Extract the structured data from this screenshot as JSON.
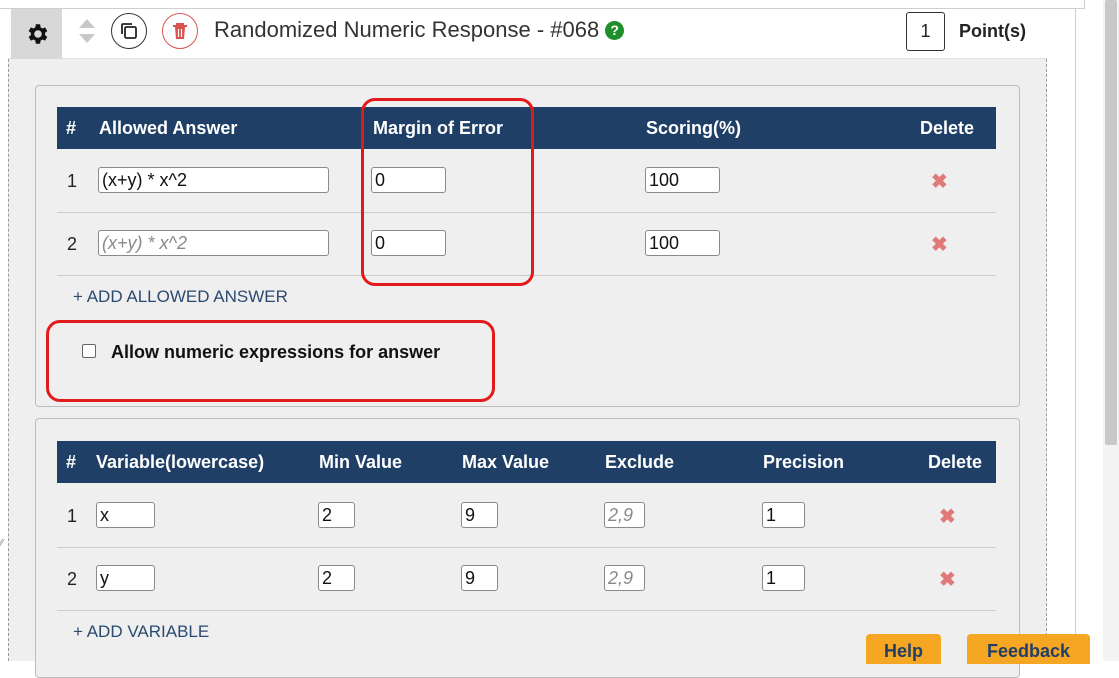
{
  "header": {
    "title": "Randomized Numeric Response - #068",
    "help_glyph": "?",
    "points_value": "1",
    "points_label": "Point(s)"
  },
  "answers": {
    "columns": [
      "#",
      "Allowed Answer",
      "Margin of Error",
      "Scoring(%)",
      "Delete"
    ],
    "rows": [
      {
        "num": "1",
        "answer": "(x+y) * x^2",
        "answer_placeholder": "",
        "margin": "0",
        "scoring": "100"
      },
      {
        "num": "2",
        "answer": "",
        "answer_placeholder": "(x+y) * x^2",
        "margin": "0",
        "scoring": "100"
      }
    ],
    "add_label": "+ ADD ALLOWED ANSWER",
    "allow_expr_label": "Allow numeric expressions for answer",
    "allow_expr_checked": false
  },
  "variables": {
    "columns": [
      "#",
      "Variable(lowercase)",
      "Min Value",
      "Max Value",
      "Exclude",
      "Precision",
      "Delete"
    ],
    "rows": [
      {
        "num": "1",
        "name": "x",
        "min": "2",
        "max": "9",
        "exclude_placeholder": "2,9",
        "precision": "1"
      },
      {
        "num": "2",
        "name": "y",
        "min": "2",
        "max": "9",
        "exclude_placeholder": "2,9",
        "precision": "1"
      }
    ],
    "add_label": "+ ADD VARIABLE"
  },
  "footer": {
    "help_label": "Help",
    "feedback_label": "Feedback"
  },
  "colors": {
    "table_header": "#1f3f66",
    "highlight": "#e11b1b",
    "delete": "#e07a7a",
    "orange": "#f5a623",
    "help_green": "#1e8f2a"
  },
  "icons": {
    "settings": "gear-icon",
    "reorder": "up-down-arrows-icon",
    "duplicate": "copy-icon",
    "remove": "trash-icon",
    "delete_row": "close-x-icon"
  }
}
